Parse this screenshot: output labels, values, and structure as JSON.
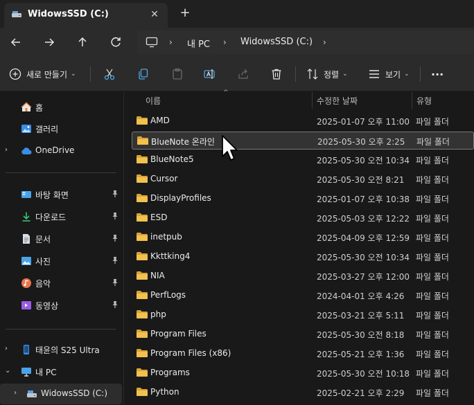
{
  "tab": {
    "title": "WidowsSSD (C:)",
    "close": "✕",
    "new_tab": "+"
  },
  "address": {
    "parts": [
      "내 PC",
      "WidowsSSD (C:)"
    ],
    "sep": "›"
  },
  "toolbar": {
    "new_label": "새로 만들기",
    "sort_label": "정렬",
    "view_label": "보기",
    "more_label": "···",
    "icons": [
      "cut-icon",
      "copy-icon",
      "paste-icon",
      "rename-icon",
      "share-icon",
      "delete-icon"
    ]
  },
  "sidebar": {
    "items": [
      {
        "label": "홈",
        "icon": "home-icon",
        "chev": ""
      },
      {
        "label": "갤러리",
        "icon": "gallery-icon",
        "chev": ""
      },
      {
        "label": "OneDrive",
        "icon": "cloud-icon",
        "chev": "›"
      },
      {
        "label": "바탕 화면",
        "icon": "desktop-icon",
        "pinned": true
      },
      {
        "label": "다운로드",
        "icon": "download-icon",
        "pinned": true
      },
      {
        "label": "문서",
        "icon": "document-icon",
        "pinned": true
      },
      {
        "label": "사진",
        "icon": "pictures-icon",
        "pinned": true
      },
      {
        "label": "음악",
        "icon": "music-icon",
        "pinned": true
      },
      {
        "label": "동영상",
        "icon": "video-icon",
        "pinned": true
      },
      {
        "label": "태윤의 S25 Ultra",
        "icon": "phone-icon",
        "chev": "›"
      },
      {
        "label": "내 PC",
        "icon": "pc-icon",
        "chev": "⌄"
      },
      {
        "label": "WidowsSSD (C:)",
        "icon": "drive-icon",
        "chev": "›"
      }
    ]
  },
  "columns": {
    "name": "이름",
    "modified": "수정한 날짜",
    "type": "유형",
    "sort_caret": "^"
  },
  "files": [
    {
      "name": "AMD",
      "date": "2025-01-07 오후 11:00",
      "type": "파일 폴더"
    },
    {
      "name": "BlueNote 온라인",
      "date": "2025-05-30 오후 2:25",
      "type": "파일 폴더"
    },
    {
      "name": "BlueNote5",
      "date": "2025-05-30 오전 10:34",
      "type": "파일 폴더"
    },
    {
      "name": "Cursor",
      "date": "2025-05-30 오전 8:21",
      "type": "파일 폴더"
    },
    {
      "name": "DisplayProfiles",
      "date": "2025-01-07 오후 10:38",
      "type": "파일 폴더"
    },
    {
      "name": "ESD",
      "date": "2025-05-03 오후 12:22",
      "type": "파일 폴더"
    },
    {
      "name": "inetpub",
      "date": "2025-04-09 오후 12:59",
      "type": "파일 폴더"
    },
    {
      "name": "Kkttking4",
      "date": "2025-05-30 오전 10:34",
      "type": "파일 폴더"
    },
    {
      "name": "NIA",
      "date": "2025-03-27 오후 12:00",
      "type": "파일 폴더"
    },
    {
      "name": "PerfLogs",
      "date": "2024-04-01 오후 4:26",
      "type": "파일 폴더"
    },
    {
      "name": "php",
      "date": "2025-03-21 오후 5:11",
      "type": "파일 폴더"
    },
    {
      "name": "Program Files",
      "date": "2025-05-30 오전 8:18",
      "type": "파일 폴더"
    },
    {
      "name": "Program Files (x86)",
      "date": "2025-05-21 오후 1:36",
      "type": "파일 폴더"
    },
    {
      "name": "Programs",
      "date": "2025-05-30 오전 10:18",
      "type": "파일 폴더"
    },
    {
      "name": "Python",
      "date": "2025-02-21 오후 2:29",
      "type": "파일 폴더"
    }
  ],
  "colors": {
    "folder": "#f2c14e",
    "folder_dark": "#d9a336",
    "onedrive": "#3a8ee6",
    "accent": "#7a7a7a"
  }
}
